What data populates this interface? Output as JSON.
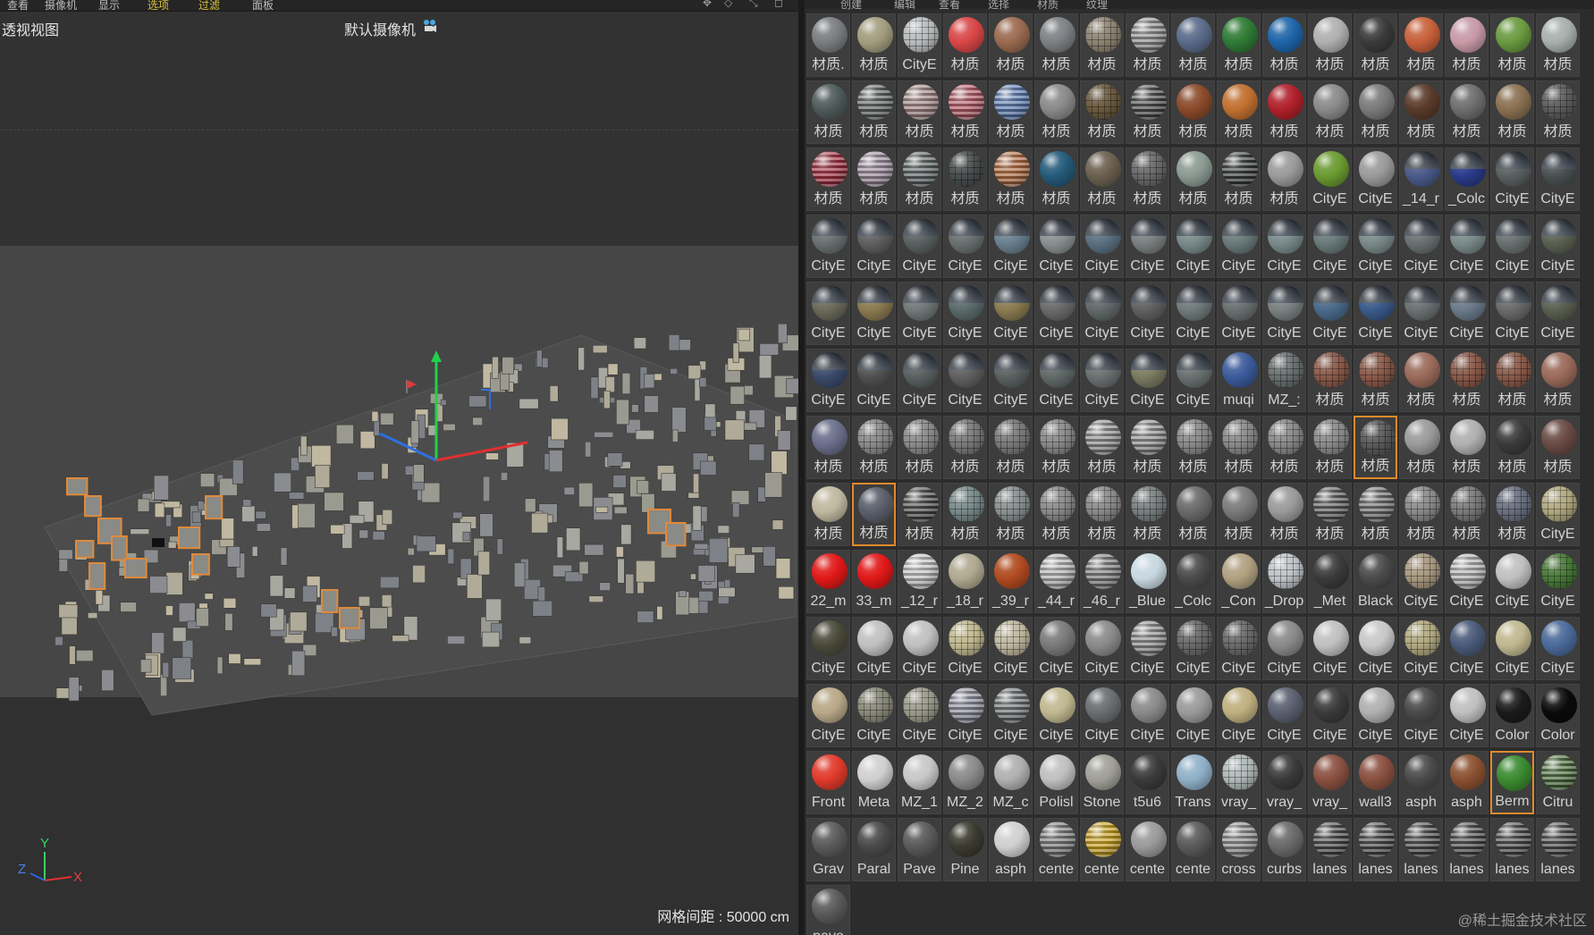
{
  "viewport": {
    "menus": [
      "查看",
      "摄像机",
      "显示",
      "选项",
      "过滤",
      "面板"
    ],
    "title": "透视视图",
    "camera": "默认摄像机",
    "grid_spacing": "网格间距 : 50000 cm",
    "axes": {
      "y": "Y",
      "z": "Z",
      "x": "X"
    }
  },
  "material_panel": {
    "menus": [
      "创建",
      "编辑",
      "查看",
      "选择",
      "材质",
      "纹理"
    ],
    "watermark": "@稀土掘金技术社区",
    "materials": [
      {
        "label": "材质.",
        "color": "#7a7d80"
      },
      {
        "label": "材质",
        "color": "#a39d7e"
      },
      {
        "label": "CityE",
        "color": "#b9bcbe",
        "style": "tiled"
      },
      {
        "label": "材质",
        "color": "#d84646",
        "selected": false
      },
      {
        "label": "材质",
        "color": "#9a6a50"
      },
      {
        "label": "材质",
        "color": "#7d8084"
      },
      {
        "label": "材质",
        "color": "#8f8472",
        "style": "tiled"
      },
      {
        "label": "材质",
        "color": "#8c8c8c",
        "style": "striped"
      },
      {
        "label": "材质",
        "color": "#5a6b8a"
      },
      {
        "label": "材质",
        "color": "#2f7a35"
      },
      {
        "label": "材质",
        "color": "#1e64a8"
      },
      {
        "label": "材质",
        "color": "#b0b0b0"
      },
      {
        "label": "材质",
        "color": "#3a3a3a"
      },
      {
        "label": "材质",
        "color": "#c7603a"
      },
      {
        "label": "材质",
        "color": "#c89aa8"
      },
      {
        "label": "材质",
        "color": "#6a9a40"
      },
      {
        "label": "材质",
        "color": "#a8b0ac"
      },
      {
        "label": "材质",
        "color": "#4f5a5a"
      },
      {
        "label": "材质",
        "color": "#5e6262",
        "style": "striped"
      },
      {
        "label": "材质",
        "color": "#a08484",
        "style": "striped"
      },
      {
        "label": "材质",
        "color": "#b25a66",
        "style": "striped"
      },
      {
        "label": "材质",
        "color": "#5a7ab0",
        "style": "striped"
      },
      {
        "label": "材质",
        "color": "#8a8a8a"
      },
      {
        "label": "材质",
        "color": "#6a5a3e",
        "style": "tiled"
      },
      {
        "label": "材质",
        "color": "#4a4a4a",
        "style": "striped"
      },
      {
        "label": "材质",
        "color": "#8a4a2a"
      },
      {
        "label": "材质",
        "color": "#c07030"
      },
      {
        "label": "材质",
        "color": "#b0202a"
      },
      {
        "label": "材质",
        "color": "#8a8a8a"
      },
      {
        "label": "材质",
        "color": "#7a7a7a"
      },
      {
        "label": "材质",
        "color": "#5a3a2a"
      },
      {
        "label": "材质",
        "color": "#6e6e6e"
      },
      {
        "label": "材质",
        "color": "#8a7050"
      },
      {
        "label": "材质",
        "color": "#5c5c5c",
        "style": "tiled"
      },
      {
        "label": "材质",
        "color": "#a03040",
        "style": "striped"
      },
      {
        "label": "材质",
        "color": "#9a8a9a",
        "style": "striped"
      },
      {
        "label": "材质",
        "color": "#5c6262",
        "style": "striped"
      },
      {
        "label": "材质",
        "color": "#4a4e4e",
        "style": "tiled"
      },
      {
        "label": "材质",
        "color": "#b06a40",
        "style": "striped"
      },
      {
        "label": "材质",
        "color": "#245a7a"
      },
      {
        "label": "材质",
        "color": "#6a6050"
      },
      {
        "label": "材质",
        "color": "#6a6a6a",
        "style": "tiled"
      },
      {
        "label": "材质",
        "color": "#8a9a92"
      },
      {
        "label": "材质",
        "color": "#3a3e3e",
        "style": "striped"
      },
      {
        "label": "材质",
        "color": "#9a9a9a"
      },
      {
        "label": "CityE",
        "color": "#6a9a30"
      },
      {
        "label": "CityE",
        "color": "#9a9a9a"
      },
      {
        "label": "_14_r",
        "color": "#4a5a8a",
        "style": "sky"
      },
      {
        "label": "_Colc",
        "color": "#2a3a8a",
        "style": "sky"
      },
      {
        "label": "CityE",
        "color": "#5a6060",
        "style": "sky"
      },
      {
        "label": "CityE",
        "color": "#4a5050",
        "style": "sky"
      },
      {
        "label": "CityE",
        "color": "#6a7070",
        "style": "sky"
      },
      {
        "label": "CityE",
        "color": "#606060",
        "style": "sky"
      },
      {
        "label": "CityE",
        "color": "#5a6060",
        "style": "sky"
      },
      {
        "label": "CityE",
        "color": "#6a7070",
        "style": "sky"
      },
      {
        "label": "CityE",
        "color": "#6a8090",
        "style": "sky"
      },
      {
        "label": "CityE",
        "color": "#8a9090",
        "style": "sky"
      },
      {
        "label": "CityE",
        "color": "#5a7080",
        "style": "sky"
      },
      {
        "label": "CityE",
        "color": "#7a8080",
        "style": "sky"
      },
      {
        "label": "CityE",
        "color": "#7a8a8a",
        "style": "sky"
      },
      {
        "label": "CityE",
        "color": "#6a7a7a",
        "style": "sky"
      },
      {
        "label": "CityE",
        "color": "#7a8a8a",
        "style": "sky"
      },
      {
        "label": "CityE",
        "color": "#6a7a7a",
        "style": "sky"
      },
      {
        "label": "CityE",
        "color": "#7a8a8a",
        "style": "sky"
      },
      {
        "label": "CityE",
        "color": "#6a7070",
        "style": "sky"
      },
      {
        "label": "CityE",
        "color": "#7a8a8a",
        "style": "sky"
      },
      {
        "label": "CityE",
        "color": "#6a7070",
        "style": "sky"
      },
      {
        "label": "CityE",
        "color": "#5a6050",
        "style": "sky"
      },
      {
        "label": "CityE",
        "color": "#6a6a5a",
        "style": "sky"
      },
      {
        "label": "CityE",
        "color": "#8a7a50",
        "style": "sky"
      },
      {
        "label": "CityE",
        "color": "#707878",
        "style": "sky"
      },
      {
        "label": "CityE",
        "color": "#5a6a6a",
        "style": "sky"
      },
      {
        "label": "CityE",
        "color": "#8a7a50",
        "style": "sky"
      },
      {
        "label": "CityE",
        "color": "#6a6a6a",
        "style": "sky"
      },
      {
        "label": "CityE",
        "color": "#606868",
        "style": "sky"
      },
      {
        "label": "CityE",
        "color": "#606060",
        "style": "sky"
      },
      {
        "label": "CityE",
        "color": "#707a7a",
        "style": "sky"
      },
      {
        "label": "CityE",
        "color": "#6a7070",
        "style": "sky"
      },
      {
        "label": "CityE",
        "color": "#7a8080",
        "style": "sky"
      },
      {
        "label": "CityE",
        "color": "#4a6a8a",
        "style": "sky"
      },
      {
        "label": "CityE",
        "color": "#3a5a8a",
        "style": "sky"
      },
      {
        "label": "CityE",
        "color": "#6a7070",
        "style": "sky"
      },
      {
        "label": "CityE",
        "color": "#6a7a8a",
        "style": "sky"
      },
      {
        "label": "CityE",
        "color": "#6a6a6a",
        "style": "sky"
      },
      {
        "label": "CityE",
        "color": "#5a6050",
        "style": "sky"
      },
      {
        "label": "CityE",
        "color": "#3a4a6a",
        "style": "sky"
      },
      {
        "label": "CityE",
        "color": "#505050",
        "style": "sky"
      },
      {
        "label": "CityE",
        "color": "#5a6060",
        "style": "sky"
      },
      {
        "label": "CityE",
        "color": "#606060",
        "style": "sky"
      },
      {
        "label": "CityE",
        "color": "#5a6060",
        "style": "sky"
      },
      {
        "label": "CityE",
        "color": "#606868",
        "style": "sky"
      },
      {
        "label": "CityE",
        "color": "#6a7070",
        "style": "sky"
      },
      {
        "label": "CityE",
        "color": "#7a7a60",
        "style": "sky"
      },
      {
        "label": "CityE",
        "color": "#6a7070",
        "style": "sky"
      },
      {
        "label": "muqi",
        "color": "#3a5a9a"
      },
      {
        "label": "MZ_:",
        "color": "#6a7070",
        "style": "tiled"
      },
      {
        "label": "材质",
        "color": "#8a5a4a",
        "style": "tiled"
      },
      {
        "label": "材质",
        "color": "#8a5a4a",
        "style": "tiled"
      },
      {
        "label": "材质",
        "color": "#9a6a5a"
      },
      {
        "label": "材质",
        "color": "#8a5a4a",
        "style": "tiled"
      },
      {
        "label": "材质",
        "color": "#8a5a4a",
        "style": "tiled"
      },
      {
        "label": "材质",
        "color": "#9a6a5a"
      },
      {
        "label": "材质",
        "color": "#6a6e8a"
      },
      {
        "label": "材质",
        "color": "#8a8a8a",
        "style": "tiled"
      },
      {
        "label": "材质",
        "color": "#8a8a8a",
        "style": "tiled"
      },
      {
        "label": "材质",
        "color": "#7a7a7a",
        "style": "tiled"
      },
      {
        "label": "材质",
        "color": "#7a7a7a",
        "style": "tiled"
      },
      {
        "label": "材质",
        "color": "#8a8a8a",
        "style": "tiled"
      },
      {
        "label": "材质",
        "color": "#8a8a8a",
        "style": "striped"
      },
      {
        "label": "材质",
        "color": "#8a8a8a",
        "style": "striped"
      },
      {
        "label": "材质",
        "color": "#8a8a8a",
        "style": "tiled"
      },
      {
        "label": "材质",
        "color": "#8a8a8a",
        "style": "tiled"
      },
      {
        "label": "材质",
        "color": "#8a8a8a",
        "style": "tiled"
      },
      {
        "label": "材质",
        "color": "#8a8a8a",
        "style": "tiled"
      },
      {
        "label": "材质",
        "color": "#5a5a5a",
        "style": "tiled",
        "selected": true
      },
      {
        "label": "材质",
        "color": "#9a9a9a"
      },
      {
        "label": "材质",
        "color": "#b0b0b0"
      },
      {
        "label": "材质",
        "color": "#3a3a3a"
      },
      {
        "label": "材质",
        "color": "#6a4a44"
      },
      {
        "label": "材质",
        "color": "#c0b8a0"
      },
      {
        "label": "材质",
        "color": "#5a5e6a",
        "selected": true
      },
      {
        "label": "材质",
        "color": "#4a4a4a",
        "style": "striped"
      },
      {
        "label": "材质",
        "color": "#7a8a8a",
        "style": "tiled"
      },
      {
        "label": "材质",
        "color": "#8a9090",
        "style": "tiled"
      },
      {
        "label": "材质",
        "color": "#8a8a8a",
        "style": "tiled"
      },
      {
        "label": "材质",
        "color": "#8a8a8a",
        "style": "tiled"
      },
      {
        "label": "材质",
        "color": "#7a8080",
        "style": "tiled"
      },
      {
        "label": "材质",
        "color": "#6a6a6a"
      },
      {
        "label": "材质",
        "color": "#7a7a7a"
      },
      {
        "label": "材质",
        "color": "#9a9a9a"
      },
      {
        "label": "材质",
        "color": "#5a5a5a",
        "style": "striped"
      },
      {
        "label": "材质",
        "color": "#6a6a6a",
        "style": "striped"
      },
      {
        "label": "材质",
        "color": "#8a8a8a",
        "style": "tiled"
      },
      {
        "label": "材质",
        "color": "#7a7a7a",
        "style": "tiled"
      },
      {
        "label": "材质",
        "color": "#6a7080",
        "style": "tiled"
      },
      {
        "label": "CityE",
        "color": "#b0a880",
        "style": "tiled"
      },
      {
        "label": "22_m",
        "color": "#e01818"
      },
      {
        "label": "33_m",
        "color": "#e01818"
      },
      {
        "label": "_12_r",
        "color": "#c0c0c0",
        "style": "striped"
      },
      {
        "label": "_18_r",
        "color": "#b0a890"
      },
      {
        "label": "_39_r",
        "color": "#b04a20"
      },
      {
        "label": "_44_r",
        "color": "#b0b0b0",
        "style": "striped"
      },
      {
        "label": "_46_r",
        "color": "#7a7a7a",
        "style": "striped"
      },
      {
        "label": "_Blue",
        "color": "#c8d8e0"
      },
      {
        "label": "_Colc",
        "color": "#4a4a4a"
      },
      {
        "label": "_Con",
        "color": "#b0a080"
      },
      {
        "label": "_Drop",
        "color": "#c0c4c8",
        "style": "tiled"
      },
      {
        "label": "_Met",
        "color": "#3a3a3a"
      },
      {
        "label": "Black",
        "color": "#4a4a4a"
      },
      {
        "label": "CityE",
        "color": "#a89880",
        "style": "tiled"
      },
      {
        "label": "CityE",
        "color": "#b0b0b0",
        "style": "striped"
      },
      {
        "label": "CityE",
        "color": "#c0c0c0"
      },
      {
        "label": "CityE",
        "color": "#4a7a3a",
        "style": "tiled"
      },
      {
        "label": "CityE",
        "color": "#4a4a3a"
      },
      {
        "label": "CityE",
        "color": "#c0c0c0"
      },
      {
        "label": "CityE",
        "color": "#c0c0c0"
      },
      {
        "label": "CityE",
        "color": "#c0b890",
        "style": "tiled"
      },
      {
        "label": "CityE",
        "color": "#c0b8a0",
        "style": "tiled"
      },
      {
        "label": "CityE",
        "color": "#7a7a7a"
      },
      {
        "label": "CityE",
        "color": "#8a8a8a"
      },
      {
        "label": "CityE",
        "color": "#8a8a8a",
        "style": "striped"
      },
      {
        "label": "CityE",
        "color": "#6a6a6a",
        "style": "tiled"
      },
      {
        "label": "CityE",
        "color": "#6a6a6a",
        "style": "tiled"
      },
      {
        "label": "CityE",
        "color": "#8a8a8a"
      },
      {
        "label": "CityE",
        "color": "#c0c0c0"
      },
      {
        "label": "CityE",
        "color": "#c8c8c8"
      },
      {
        "label": "CityE",
        "color": "#b0a880",
        "style": "tiled"
      },
      {
        "label": "CityE",
        "color": "#4a5a7a"
      },
      {
        "label": "CityE",
        "color": "#c0b890"
      },
      {
        "label": "CityE",
        "color": "#4a6a9a"
      },
      {
        "label": "CityE",
        "color": "#b8a888"
      },
      {
        "label": "CityE",
        "color": "#8a8a7a",
        "style": "tiled"
      },
      {
        "label": "CityE",
        "color": "#9a9a8a",
        "style": "tiled"
      },
      {
        "label": "CityE",
        "color": "#8a8a9a",
        "style": "striped"
      },
      {
        "label": "CityE",
        "color": "#6a7070",
        "style": "striped"
      },
      {
        "label": "CityE",
        "color": "#c0b890"
      },
      {
        "label": "CityE",
        "color": "#6a6e70"
      },
      {
        "label": "CityE",
        "color": "#8a8a8a"
      },
      {
        "label": "CityE",
        "color": "#9a9a9a"
      },
      {
        "label": "CityE",
        "color": "#c0b080"
      },
      {
        "label": "CityE",
        "color": "#5a6070"
      },
      {
        "label": "CityE",
        "color": "#3a3a3a"
      },
      {
        "label": "CityE",
        "color": "#b0b0b0"
      },
      {
        "label": "CityE",
        "color": "#4a4a4a"
      },
      {
        "label": "CityE",
        "color": "#c0c0c0"
      },
      {
        "label": "Color",
        "color": "#1a1a1a"
      },
      {
        "label": "Color",
        "color": "#0a0a0a"
      },
      {
        "label": "Front",
        "color": "#e03a2a"
      },
      {
        "label": "Meta",
        "color": "#d0d0d0"
      },
      {
        "label": "MZ_1",
        "color": "#c8c8c8"
      },
      {
        "label": "MZ_2",
        "color": "#8a8a8a"
      },
      {
        "label": "MZ_c",
        "color": "#b0b0b0"
      },
      {
        "label": "Polisl",
        "color": "#c0c0c0"
      },
      {
        "label": "Stone",
        "color": "#a0a098"
      },
      {
        "label": "t5u6",
        "color": "#3a3a3a"
      },
      {
        "label": "Trans",
        "color": "#90b0c8"
      },
      {
        "label": "vray_",
        "color": "#b0b8b8",
        "style": "tiled"
      },
      {
        "label": "vray_",
        "color": "#3a3a3a"
      },
      {
        "label": "vray_",
        "color": "#8a5040"
      },
      {
        "label": "wall3",
        "color": "#8a5040"
      },
      {
        "label": "asph",
        "color": "#4a4a4a"
      },
      {
        "label": "asph",
        "color": "#8a5030"
      },
      {
        "label": "Berm",
        "color": "#3a8a30",
        "selected": true
      },
      {
        "label": "Citru",
        "color": "#4a6a3a",
        "style": "striped"
      },
      {
        "label": "Grav",
        "color": "#5a5a5a"
      },
      {
        "label": "Paral",
        "color": "#4a4a4a"
      },
      {
        "label": "Pave",
        "color": "#5a5a5a"
      },
      {
        "label": "Pine",
        "color": "#3a3a30"
      },
      {
        "label": "asph",
        "color": "#d0d0d0"
      },
      {
        "label": "cente",
        "color": "#7a7a7a",
        "style": "striped"
      },
      {
        "label": "cente",
        "color": "#c8a020",
        "style": "striped"
      },
      {
        "label": "cente",
        "color": "#9a9a9a"
      },
      {
        "label": "cente",
        "color": "#5a5a5a"
      },
      {
        "label": "cross",
        "color": "#8a8a8a",
        "style": "striped"
      },
      {
        "label": "curbs",
        "color": "#6a6a6a"
      },
      {
        "label": "lanes",
        "color": "#4a4a4a",
        "style": "striped"
      },
      {
        "label": "lanes",
        "color": "#4a4a4a",
        "style": "striped"
      },
      {
        "label": "lanes",
        "color": "#4a4a4a",
        "style": "striped"
      },
      {
        "label": "lanes",
        "color": "#4a4a4a",
        "style": "striped"
      },
      {
        "label": "lanes",
        "color": "#4a4a4a",
        "style": "striped"
      },
      {
        "label": "lanes",
        "color": "#4a4a4a",
        "style": "striped"
      },
      {
        "label": "pave",
        "color": "#5a5a5a"
      }
    ]
  }
}
